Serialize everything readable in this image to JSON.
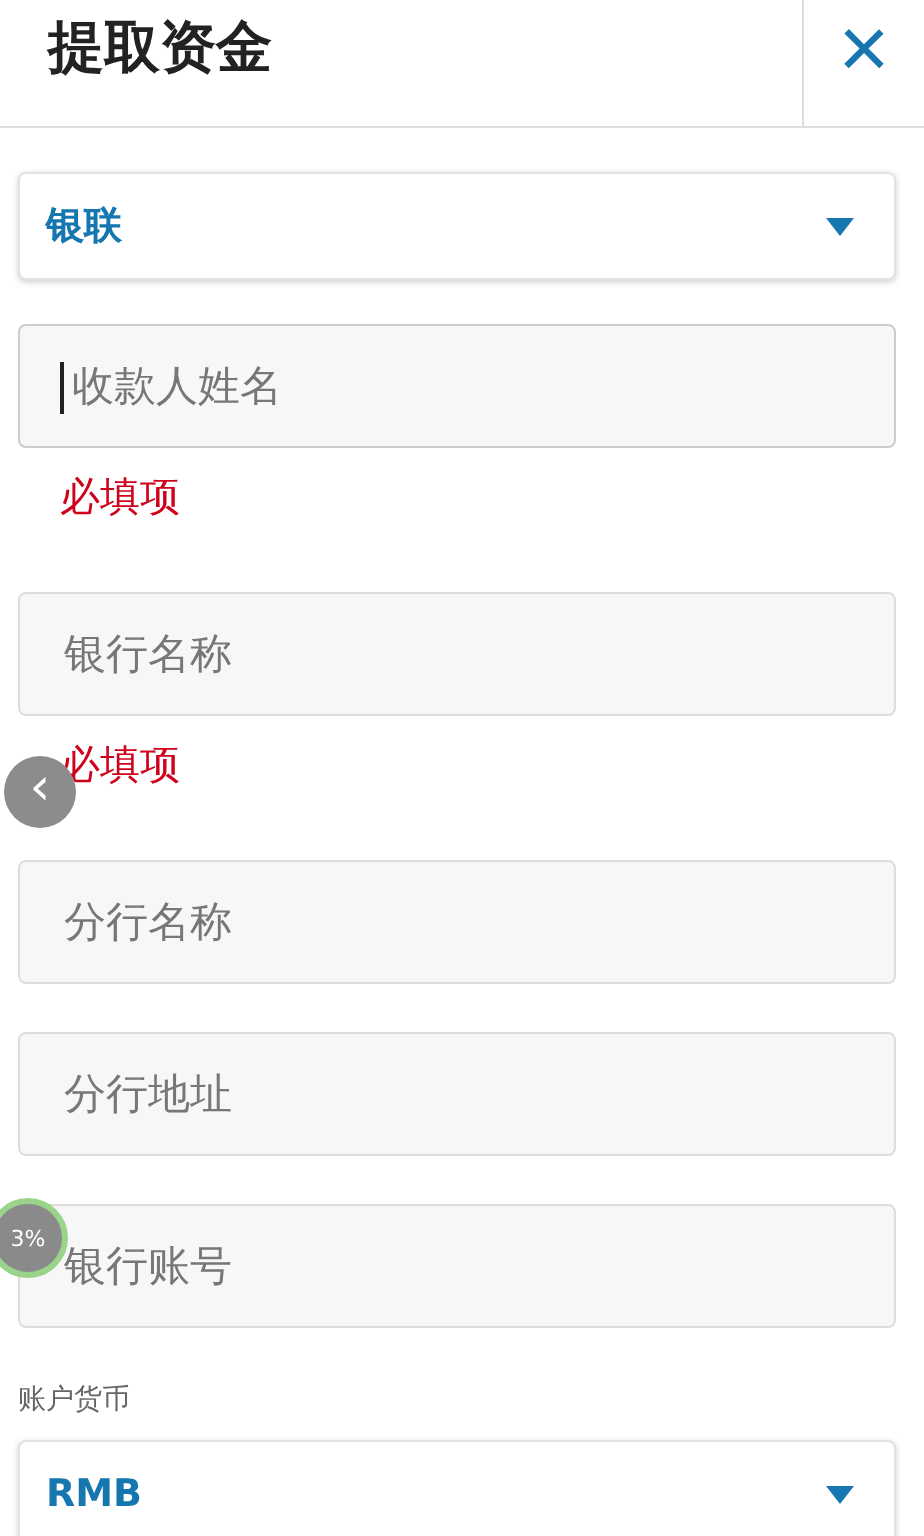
{
  "header": {
    "title": "提取资金",
    "close": "×"
  },
  "form": [
    {
      "kind": "select",
      "value": "银联"
    },
    {
      "kind": "input",
      "placeholder": "收款人姓名",
      "focused": true,
      "error": "必填项"
    },
    {
      "kind": "input",
      "placeholder": "银行名称",
      "focused": false,
      "error": "必填项"
    },
    {
      "kind": "input",
      "placeholder": "分行名称",
      "focused": false
    },
    {
      "kind": "input",
      "placeholder": "分行地址",
      "focused": false
    },
    {
      "kind": "input",
      "placeholder": "银行账号",
      "focused": false
    },
    {
      "kind": "select",
      "label": "账户货币",
      "value": "RMB"
    }
  ],
  "overlays": {
    "back_button": "‹",
    "progress": "3%"
  }
}
